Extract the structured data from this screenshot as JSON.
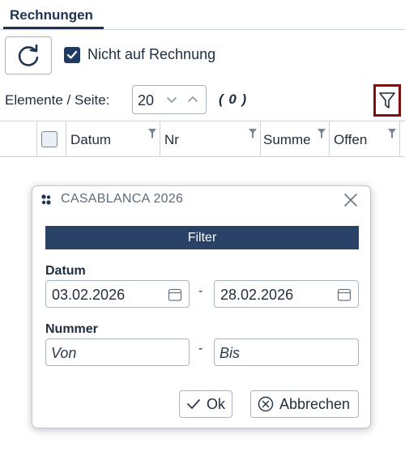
{
  "tabs": [
    {
      "label": "Rechnungen",
      "active": true
    }
  ],
  "toolbar": {
    "refresh_icon": "refresh-icon",
    "checkbox_checked": true,
    "checkbox_label": "Nicht auf Rechnung"
  },
  "paging": {
    "label": "Elemente / Seite:",
    "page_size": "20",
    "count": "( 0 )",
    "filter_icon": "filter-icon"
  },
  "grid": {
    "columns": [
      "Datum",
      "Nr",
      "Summe",
      "Offen"
    ]
  },
  "dialog": {
    "title": "CASABLANCA 2026",
    "header": "Filter",
    "date_section": {
      "label": "Datum",
      "from_value": "03.02.2026",
      "to_value": "28.02.2026",
      "separator": "-"
    },
    "number_section": {
      "label": "Nummer",
      "from_placeholder": "Von",
      "to_placeholder": "Bis",
      "separator": "-"
    },
    "buttons": {
      "ok_label": "Ok",
      "cancel_label": "Abbrechen"
    }
  },
  "colors": {
    "accent": "#2a4266",
    "highlight_border": "#7a1212",
    "text": "#1f2d3d"
  }
}
